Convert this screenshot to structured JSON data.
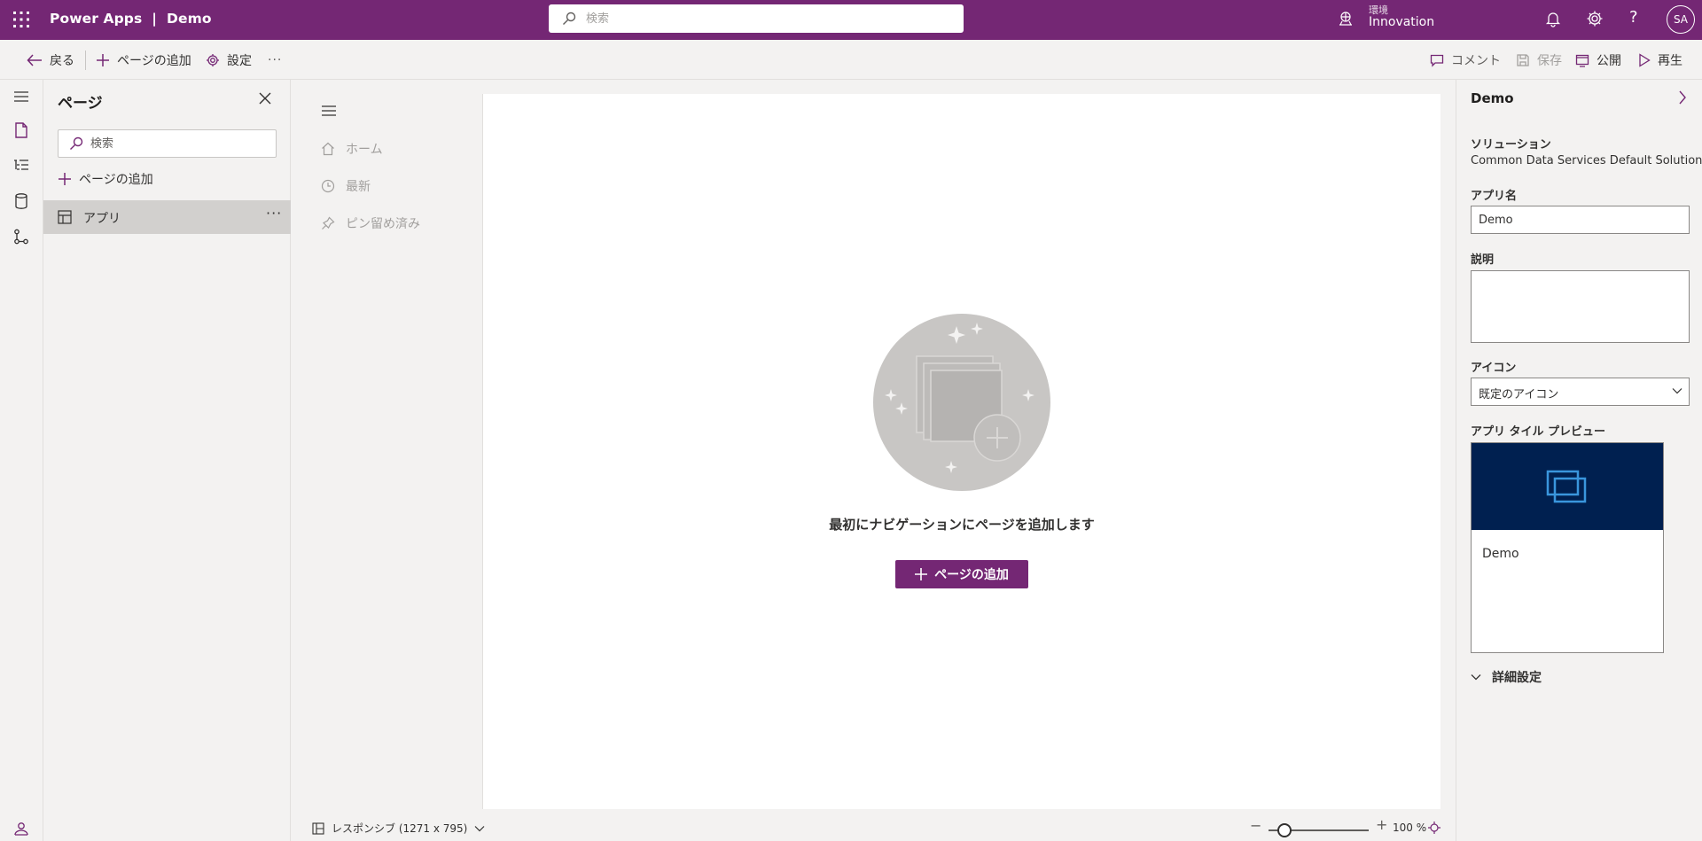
{
  "header": {
    "app_title": "Power Apps  |  Demo",
    "search_placeholder": "検索",
    "env_label": "環境",
    "env_name": "Innovation",
    "help_glyph": "?",
    "avatar_initials": "SA"
  },
  "commands": {
    "back": "戻る",
    "add_page": "ページの追加",
    "settings": "設定",
    "more": "···",
    "comment": "コメント",
    "save": "保存",
    "publish": "公開",
    "play": "再生"
  },
  "pages_panel": {
    "title": "ページ",
    "search_placeholder": "検索",
    "add_page": "ページの追加",
    "items": [
      {
        "label": "アプリ",
        "more": "···"
      }
    ]
  },
  "nav_preview": {
    "items": [
      {
        "label": "ホーム",
        "icon": "home-icon"
      },
      {
        "label": "最新",
        "icon": "clock-icon"
      },
      {
        "label": "ピン留め済み",
        "icon": "pin-icon"
      }
    ]
  },
  "canvas": {
    "empty_message": "最初にナビゲーションにページを追加します",
    "add_page_button": "ページの追加"
  },
  "status_bar": {
    "layout": "レスポンシブ (1271 x 795)",
    "zoom": "100 %",
    "zoom_minus": "−",
    "zoom_plus": "+",
    "zoom_level": 1.0
  },
  "properties": {
    "title": "Demo",
    "solution_label": "ソリューション",
    "solution_value": "Common Data Services Default Solution",
    "app_name_label": "アプリ名",
    "app_name_value": "Demo",
    "description_label": "説明",
    "description_value": "",
    "icon_label": "アイコン",
    "icon_value": "既定のアイコン",
    "tile_preview_label": "アプリ タイル プレビュー",
    "tile_name": "Demo",
    "advanced_settings": "詳細設定"
  },
  "colors": {
    "brand": "#742774",
    "tile_background": "#002050",
    "tile_icon": "#3a96dd"
  }
}
